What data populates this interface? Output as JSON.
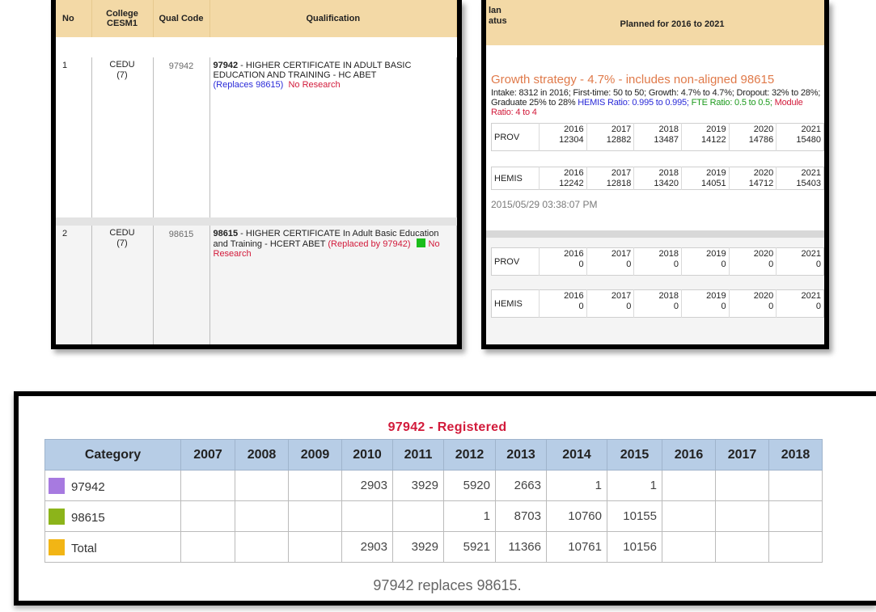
{
  "qual_table": {
    "headers": [
      "No",
      "College CESM1",
      "Qual Code",
      "Qualification"
    ],
    "rows": [
      {
        "no": "1",
        "college": "CEDU",
        "college_sub": "(7)",
        "code": "97942",
        "qual_code_bold": "97942",
        "qual_title": " - HIGHER CERTIFICATE IN ADULT BASIC EDUCATION AND TRAINING - HC ABET",
        "replaces": "(Replaces 98615)",
        "research": "No Research"
      },
      {
        "no": "2",
        "college": "CEDU",
        "college_sub": "(7)",
        "code": "98615",
        "qual_code_bold": "98615",
        "qual_title": " - HIGHER CERTIFICATE In Adult Basic Education and Training - HCERT ABET",
        "replaced_by": "(Replaced by 97942)",
        "research": "No Research"
      }
    ]
  },
  "plan_panel": {
    "header_status": "lan\natus",
    "header_title": "Planned for 2016 to 2021",
    "growth_strategy": "Growth strategy - 4.7% - includes non-aligned 98615",
    "desc_black": "Intake: 8312 in 2016; First-time: 50 to 50; Growth: 4.7% to 4.7%; Dropout: 32% to 28%; Graduate 25% to 28% ",
    "desc_hemis": "HEMIS Ratio: 0.995 to 0.995;",
    "desc_fte": " FTE Ratio: 0.5 to 0.5;",
    "desc_module": " Module Ratio: 4 to 4",
    "timestamp": "2015/05/29 03:38:07 PM",
    "years": [
      "2016",
      "2017",
      "2018",
      "2019",
      "2020",
      "2021"
    ],
    "row1_prov_label": "PROV",
    "row1_prov": [
      "12304",
      "12882",
      "13487",
      "14122",
      "14786",
      "15480"
    ],
    "row1_hemis_label": "HEMIS",
    "row1_hemis": [
      "12242",
      "12818",
      "13420",
      "14051",
      "14712",
      "15403"
    ],
    "row2_prov_label": "PROV",
    "row2_prov": [
      "0",
      "0",
      "0",
      "0",
      "0",
      "0"
    ],
    "row2_hemis_label": "HEMIS",
    "row2_hemis": [
      "0",
      "0",
      "0",
      "0",
      "0",
      "0"
    ]
  },
  "registered": {
    "title": "97942 - Registered",
    "headers": [
      "Category",
      "2007",
      "2008",
      "2009",
      "2010",
      "2011",
      "2012",
      "2013",
      "2014",
      "2015",
      "2016",
      "2017",
      "2018"
    ],
    "rows": [
      {
        "category": "97942",
        "color": "#a77ae0",
        "values": [
          "",
          "",
          "",
          "2903",
          "3929",
          "5920",
          "2663",
          "1",
          "1",
          "",
          "",
          ""
        ]
      },
      {
        "category": "98615",
        "color": "#8cb41a",
        "values": [
          "",
          "",
          "",
          "",
          "",
          "1",
          "8703",
          "10760",
          "10155",
          "",
          "",
          ""
        ]
      },
      {
        "category": "Total",
        "color": "#f2b515",
        "values": [
          "",
          "",
          "",
          "2903",
          "3929",
          "5921",
          "11366",
          "10761",
          "10156",
          "",
          "",
          ""
        ]
      }
    ],
    "note": "97942 replaces 98615."
  }
}
